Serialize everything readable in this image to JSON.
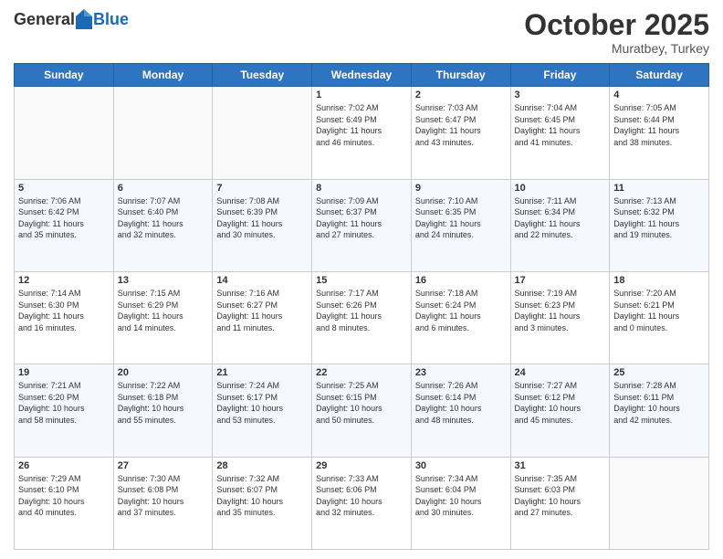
{
  "header": {
    "logo_general": "General",
    "logo_blue": "Blue",
    "month": "October 2025",
    "location": "Muratbey, Turkey"
  },
  "days_of_week": [
    "Sunday",
    "Monday",
    "Tuesday",
    "Wednesday",
    "Thursday",
    "Friday",
    "Saturday"
  ],
  "weeks": [
    [
      {
        "day": "",
        "info": ""
      },
      {
        "day": "",
        "info": ""
      },
      {
        "day": "",
        "info": ""
      },
      {
        "day": "1",
        "info": "Sunrise: 7:02 AM\nSunset: 6:49 PM\nDaylight: 11 hours\nand 46 minutes."
      },
      {
        "day": "2",
        "info": "Sunrise: 7:03 AM\nSunset: 6:47 PM\nDaylight: 11 hours\nand 43 minutes."
      },
      {
        "day": "3",
        "info": "Sunrise: 7:04 AM\nSunset: 6:45 PM\nDaylight: 11 hours\nand 41 minutes."
      },
      {
        "day": "4",
        "info": "Sunrise: 7:05 AM\nSunset: 6:44 PM\nDaylight: 11 hours\nand 38 minutes."
      }
    ],
    [
      {
        "day": "5",
        "info": "Sunrise: 7:06 AM\nSunset: 6:42 PM\nDaylight: 11 hours\nand 35 minutes."
      },
      {
        "day": "6",
        "info": "Sunrise: 7:07 AM\nSunset: 6:40 PM\nDaylight: 11 hours\nand 32 minutes."
      },
      {
        "day": "7",
        "info": "Sunrise: 7:08 AM\nSunset: 6:39 PM\nDaylight: 11 hours\nand 30 minutes."
      },
      {
        "day": "8",
        "info": "Sunrise: 7:09 AM\nSunset: 6:37 PM\nDaylight: 11 hours\nand 27 minutes."
      },
      {
        "day": "9",
        "info": "Sunrise: 7:10 AM\nSunset: 6:35 PM\nDaylight: 11 hours\nand 24 minutes."
      },
      {
        "day": "10",
        "info": "Sunrise: 7:11 AM\nSunset: 6:34 PM\nDaylight: 11 hours\nand 22 minutes."
      },
      {
        "day": "11",
        "info": "Sunrise: 7:13 AM\nSunset: 6:32 PM\nDaylight: 11 hours\nand 19 minutes."
      }
    ],
    [
      {
        "day": "12",
        "info": "Sunrise: 7:14 AM\nSunset: 6:30 PM\nDaylight: 11 hours\nand 16 minutes."
      },
      {
        "day": "13",
        "info": "Sunrise: 7:15 AM\nSunset: 6:29 PM\nDaylight: 11 hours\nand 14 minutes."
      },
      {
        "day": "14",
        "info": "Sunrise: 7:16 AM\nSunset: 6:27 PM\nDaylight: 11 hours\nand 11 minutes."
      },
      {
        "day": "15",
        "info": "Sunrise: 7:17 AM\nSunset: 6:26 PM\nDaylight: 11 hours\nand 8 minutes."
      },
      {
        "day": "16",
        "info": "Sunrise: 7:18 AM\nSunset: 6:24 PM\nDaylight: 11 hours\nand 6 minutes."
      },
      {
        "day": "17",
        "info": "Sunrise: 7:19 AM\nSunset: 6:23 PM\nDaylight: 11 hours\nand 3 minutes."
      },
      {
        "day": "18",
        "info": "Sunrise: 7:20 AM\nSunset: 6:21 PM\nDaylight: 11 hours\nand 0 minutes."
      }
    ],
    [
      {
        "day": "19",
        "info": "Sunrise: 7:21 AM\nSunset: 6:20 PM\nDaylight: 10 hours\nand 58 minutes."
      },
      {
        "day": "20",
        "info": "Sunrise: 7:22 AM\nSunset: 6:18 PM\nDaylight: 10 hours\nand 55 minutes."
      },
      {
        "day": "21",
        "info": "Sunrise: 7:24 AM\nSunset: 6:17 PM\nDaylight: 10 hours\nand 53 minutes."
      },
      {
        "day": "22",
        "info": "Sunrise: 7:25 AM\nSunset: 6:15 PM\nDaylight: 10 hours\nand 50 minutes."
      },
      {
        "day": "23",
        "info": "Sunrise: 7:26 AM\nSunset: 6:14 PM\nDaylight: 10 hours\nand 48 minutes."
      },
      {
        "day": "24",
        "info": "Sunrise: 7:27 AM\nSunset: 6:12 PM\nDaylight: 10 hours\nand 45 minutes."
      },
      {
        "day": "25",
        "info": "Sunrise: 7:28 AM\nSunset: 6:11 PM\nDaylight: 10 hours\nand 42 minutes."
      }
    ],
    [
      {
        "day": "26",
        "info": "Sunrise: 7:29 AM\nSunset: 6:10 PM\nDaylight: 10 hours\nand 40 minutes."
      },
      {
        "day": "27",
        "info": "Sunrise: 7:30 AM\nSunset: 6:08 PM\nDaylight: 10 hours\nand 37 minutes."
      },
      {
        "day": "28",
        "info": "Sunrise: 7:32 AM\nSunset: 6:07 PM\nDaylight: 10 hours\nand 35 minutes."
      },
      {
        "day": "29",
        "info": "Sunrise: 7:33 AM\nSunset: 6:06 PM\nDaylight: 10 hours\nand 32 minutes."
      },
      {
        "day": "30",
        "info": "Sunrise: 7:34 AM\nSunset: 6:04 PM\nDaylight: 10 hours\nand 30 minutes."
      },
      {
        "day": "31",
        "info": "Sunrise: 7:35 AM\nSunset: 6:03 PM\nDaylight: 10 hours\nand 27 minutes."
      },
      {
        "day": "",
        "info": ""
      }
    ]
  ]
}
